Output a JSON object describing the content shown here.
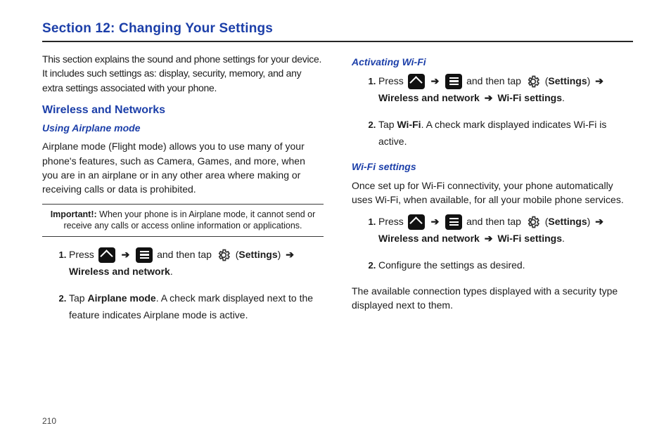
{
  "section_title": "Section 12: Changing Your Settings",
  "page_number": "210",
  "intro": "This section explains the sound and phone settings for your device. It includes such settings as: display, security, memory, and any extra settings associated with your phone.",
  "h2_wireless": "Wireless and Networks",
  "h3_airplane": "Using Airplane mode",
  "airplane_desc": "Airplane mode (Flight mode) allows you to use many of your phone's features, such as Camera, Games, and more, when you are in an airplane or in any other area where making or receiving calls or data is prohibited.",
  "important_label": "Important!:",
  "important_text": "When your phone is in Airplane mode, it cannot send or receive any calls or access online information or applications.",
  "press": "Press",
  "and_then_tap": "and then tap",
  "settings_label": "Settings",
  "arrow": "➔",
  "wireless_network_b": "Wireless and network",
  "period": ".",
  "wifi_settings_b": "Wi-Fi settings",
  "airplane_step2_a": "Tap ",
  "airplane_step2_b": "Airplane mode",
  "airplane_step2_c": ". A check mark displayed next to the feature indicates Airplane mode is active.",
  "h3_activating": "Activating Wi-Fi",
  "activating_step2_a": "Tap ",
  "activating_step2_b": "Wi-Fi",
  "activating_step2_c": ". A check mark displayed indicates Wi-Fi is active.",
  "h3_wifi_settings": "Wi-Fi settings",
  "wifi_desc": "Once set up for Wi-Fi connectivity, your phone automatically uses Wi-Fi, when available, for all your mobile phone services.",
  "wifi_step2": "Configure the settings as desired.",
  "wifi_closing": "The available connection types displayed with a security type displayed next to them."
}
